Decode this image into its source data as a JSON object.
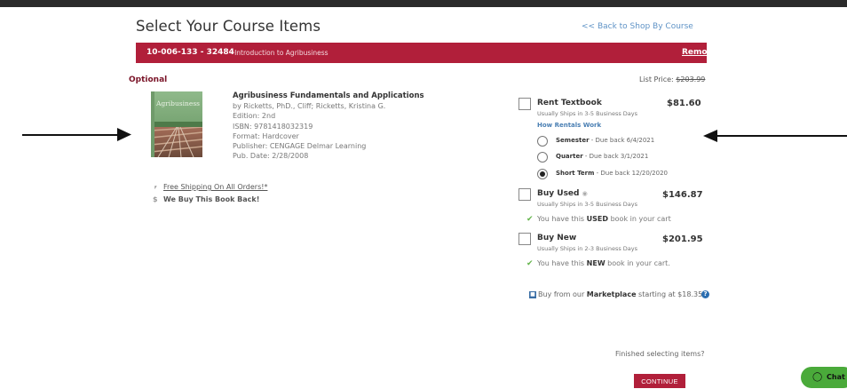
{
  "header": {
    "title": "Select Your Course Items",
    "back_link": "<< Back to Shop By Course"
  },
  "course": {
    "code": "10-006-133 - 32484",
    "name": "- Introduction to Agribusiness",
    "remove_label": "Remove"
  },
  "item": {
    "optional_label": "Optional",
    "list_price_label": "List Price:",
    "list_price_value": "$203.99",
    "cover_text": "Agribusiness",
    "title": "Agribusiness Fundamentals and Applications",
    "authors": "by Ricketts, PhD., Cliff; Ricketts, Kristina G.",
    "edition": "Edition: 2nd",
    "isbn": "ISBN: 9781418032319",
    "format": "Format: Hardcover",
    "publisher": "Publisher: CENGAGE Delmar Learning",
    "pub_date": "Pub. Date: 2/28/2008",
    "free_shipping": "Free Shipping On All Orders!*",
    "buyback": "We Buy This Book Back!"
  },
  "options": {
    "rent": {
      "title": "Rent Textbook",
      "sub": "Usually Ships in 3-5 Business Days",
      "price": "$81.60",
      "how_link": "How Rentals Work",
      "terms": [
        {
          "name": "Semester",
          "due": "- Due back 6/4/2021",
          "selected": false
        },
        {
          "name": "Quarter",
          "due": "- Due back 3/1/2021",
          "selected": false
        },
        {
          "name": "Short Term",
          "due": "- Due back 12/20/2020",
          "selected": true
        }
      ]
    },
    "used": {
      "title": "Buy Used",
      "sub": "Usually Ships in 3-5 Business Days",
      "price": "$146.87",
      "cart_pre": "You have this ",
      "cart_bold": "USED",
      "cart_post": " book in your cart"
    },
    "new": {
      "title": "Buy New",
      "sub": "Usually Ships in 2-3 Business Days",
      "price": "$201.95",
      "cart_pre": "You have this ",
      "cart_bold": "NEW",
      "cart_post": " book in your cart."
    },
    "marketplace": {
      "pre": "Buy from our ",
      "bold": "Marketplace",
      "post": " starting at $18.35"
    }
  },
  "footer": {
    "finished": "Finished selecting items?",
    "continue_label": "CONTINUE"
  },
  "chat": {
    "label": "Chat"
  },
  "colors": {
    "brand_red": "#b11f3a",
    "link_blue": "#5f93c6",
    "check_green": "#63b44a",
    "chat_green": "#4aaa3a"
  }
}
